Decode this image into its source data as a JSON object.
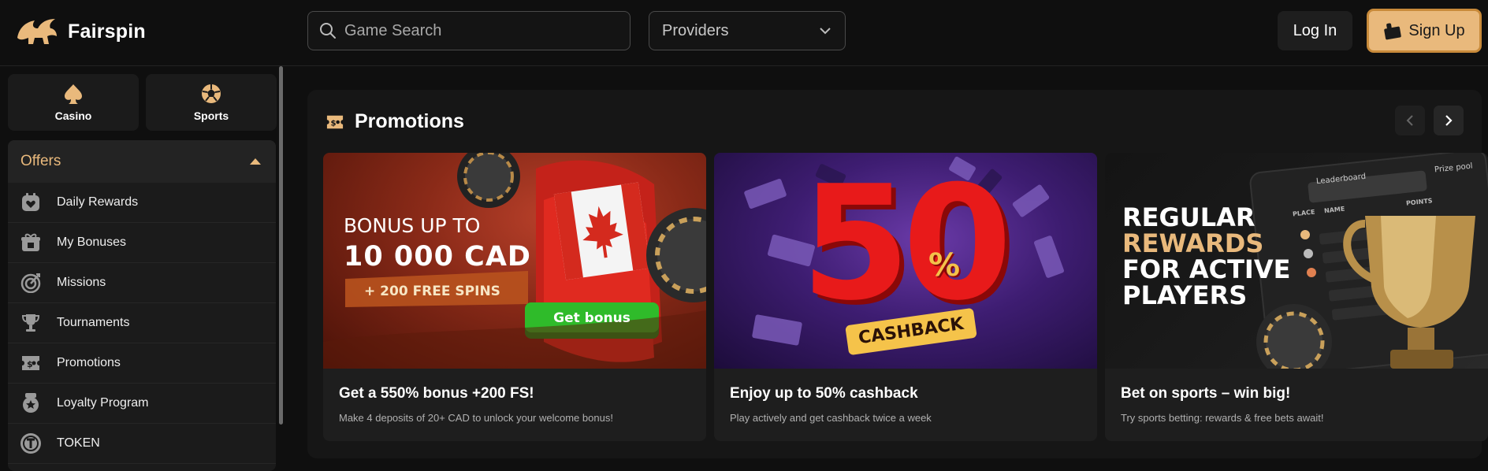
{
  "header": {
    "brand": "Fairspin",
    "search_placeholder": "Game Search",
    "providers_label": "Providers",
    "login_label": "Log In",
    "signup_label": "Sign Up"
  },
  "sidebar": {
    "tiles": [
      {
        "label": "Casino",
        "icon": "spade-icon"
      },
      {
        "label": "Sports",
        "icon": "soccer-ball-icon"
      }
    ],
    "offers_label": "Offers",
    "items": [
      {
        "label": "Daily Rewards",
        "icon": "calendar-heart-icon"
      },
      {
        "label": "My Bonuses",
        "icon": "gift-icon"
      },
      {
        "label": "Missions",
        "icon": "target-icon"
      },
      {
        "label": "Tournaments",
        "icon": "trophy-icon"
      },
      {
        "label": "Promotions",
        "icon": "ticket-icon"
      },
      {
        "label": "Loyalty Program",
        "icon": "badge-icon"
      },
      {
        "label": "TOKEN",
        "icon": "token-icon"
      }
    ]
  },
  "promotions": {
    "title": "Promotions",
    "cards": [
      {
        "banner_line1": "BONUS UP TO",
        "banner_line2": "10 000 CAD",
        "banner_line3": "+ 200 FREE SPINS",
        "banner_button": "Get bonus",
        "title": "Get a 550% bonus +200 FS!",
        "subtitle": "Make 4 deposits of 20+ CAD to unlock your welcome bonus!"
      },
      {
        "banner_big": "50",
        "banner_percent": "%",
        "banner_tag": "CASHBACK",
        "title": "Enjoy up to 50% cashback",
        "subtitle": "Play actively and get cashback twice a week"
      },
      {
        "banner_line1": "REGULAR",
        "banner_line2": "REWARDS",
        "banner_line3": "FOR ACTIVE",
        "banner_line4": "PLAYERS",
        "board_tab1": "Leaderboard",
        "board_tab2": "Prize pool",
        "board_col1": "PLACE",
        "board_col2": "NAME",
        "board_col3": "POINTS",
        "title": "Bet on sports – win big!",
        "subtitle": "Try sports betting: rewards & free bets await!"
      }
    ]
  },
  "colors": {
    "accent": "#e9b97c",
    "background": "#0f0f0f",
    "panel": "#161616",
    "card": "#1e1e1e"
  }
}
